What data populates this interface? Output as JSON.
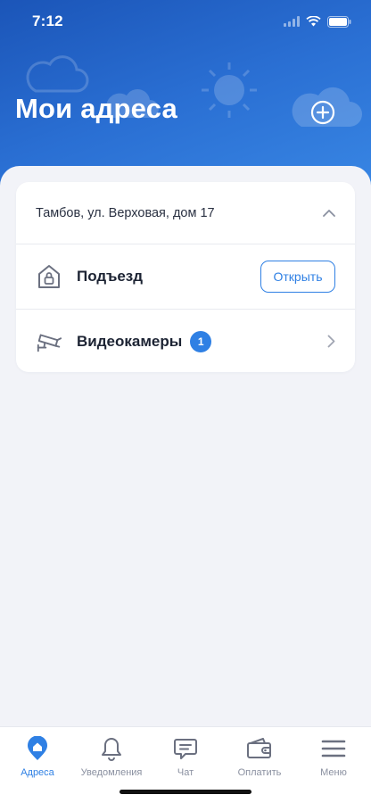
{
  "status_bar": {
    "time": "7:12"
  },
  "header": {
    "title": "Мои адреса"
  },
  "address_card": {
    "address": "Тамбов, ул. Верховая, дом 17",
    "rows": [
      {
        "label": "Подъезд",
        "icon": "house-lock-icon",
        "action_label": "Открыть"
      },
      {
        "label": "Видеокамеры",
        "icon": "security-camera-icon",
        "badge": "1"
      }
    ]
  },
  "tabbar": {
    "tabs": [
      {
        "label": "Адреса",
        "icon": "home-pin-icon",
        "active": true
      },
      {
        "label": "Уведомления",
        "icon": "bell-icon",
        "active": false
      },
      {
        "label": "Чат",
        "icon": "chat-icon",
        "active": false
      },
      {
        "label": "Оплатить",
        "icon": "wallet-icon",
        "active": false
      },
      {
        "label": "Меню",
        "icon": "menu-icon",
        "active": false
      }
    ]
  },
  "colors": {
    "accent": "#2f80e4",
    "header_gradient_start": "#1b55b8",
    "header_gradient_end": "#3c8ce8",
    "background": "#f2f3f8"
  }
}
